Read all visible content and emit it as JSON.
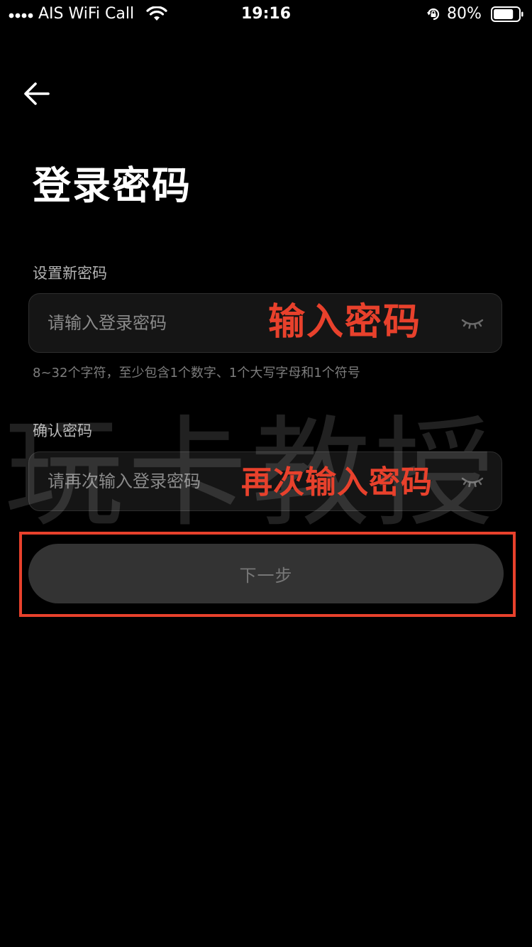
{
  "status_bar": {
    "carrier": "AIS WiFi Call",
    "time": "19:16",
    "battery": "80%"
  },
  "header": {
    "title": "登录密码"
  },
  "form": {
    "new_password": {
      "label": "设置新密码",
      "placeholder": "请输入登录密码"
    },
    "hint": "8~32个字符，至少包含1个数字、1个大写字母和1个符号",
    "confirm_password": {
      "label": "确认密码",
      "placeholder": "请再次输入登录密码"
    },
    "next_label": "下一步"
  },
  "annotations": {
    "enter_password": "输入密码",
    "reenter_password": "再次输入密码",
    "watermark": "玩卡教授"
  },
  "icons": {
    "back": "arrow-left-icon",
    "visibility": "eye-closed-icon",
    "wifi": "wifi-icon",
    "signal": "signal-dots-icon",
    "rotation_lock": "rotation-lock-icon",
    "battery": "battery-icon"
  },
  "colors": {
    "background": "#000000",
    "input_background": "#151515",
    "button_background": "#333333",
    "button_text": "#777777",
    "annotation_red": "#e8412c"
  },
  "state": {
    "battery_level": 0.8
  }
}
